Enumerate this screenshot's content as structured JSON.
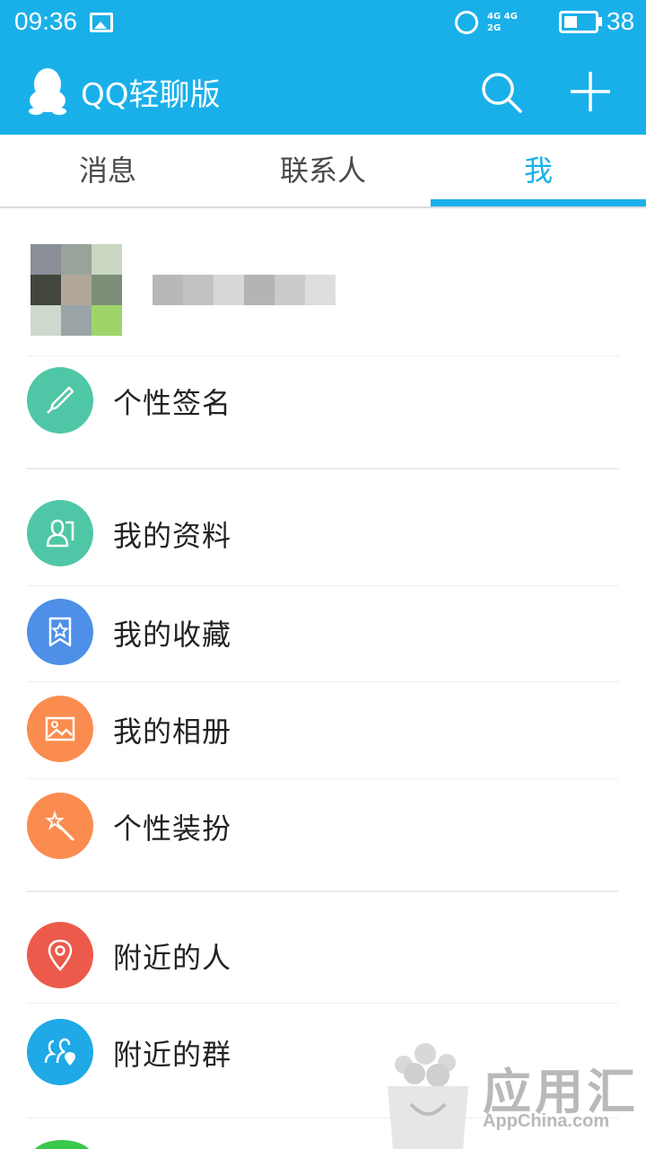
{
  "status_bar": {
    "time": "09:36",
    "network": "4G 4G",
    "network2": "2G",
    "battery_percent": "38"
  },
  "header": {
    "title": "QQ轻聊版"
  },
  "tabs": [
    {
      "label": "消息",
      "active": false
    },
    {
      "label": "联系人",
      "active": false
    },
    {
      "label": "我",
      "active": true
    }
  ],
  "menu": {
    "signature": {
      "label": "个性签名",
      "icon": "brush-icon",
      "color": "#4fc7a6"
    },
    "my_profile": {
      "label": "我的资料",
      "icon": "profile-card-icon",
      "color": "#4fc7a6"
    },
    "my_favorites": {
      "label": "我的收藏",
      "icon": "bookmark-star-icon",
      "color": "#4e8fe8"
    },
    "my_album": {
      "label": "我的相册",
      "icon": "picture-icon",
      "color": "#fb8c4f"
    },
    "personal_theme": {
      "label": "个性装扮",
      "icon": "magic-wand-icon",
      "color": "#fb8c4f"
    },
    "nearby_people": {
      "label": "附近的人",
      "icon": "location-pin-icon",
      "color": "#ec5a4b"
    },
    "nearby_groups": {
      "label": "附近的群",
      "icon": "group-location-icon",
      "color": "#1fa9e6"
    }
  },
  "watermark": {
    "text": "应用汇",
    "sub": "AppChina.com"
  },
  "colors": {
    "accent": "#19b0ea"
  }
}
